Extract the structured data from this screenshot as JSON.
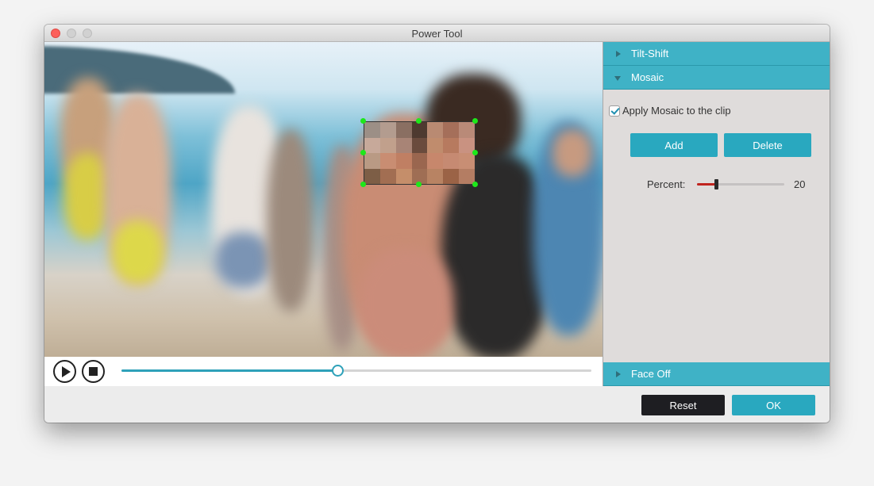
{
  "window": {
    "title": "Power Tool"
  },
  "player": {
    "play_icon": "play-icon",
    "stop_icon": "stop-icon",
    "progress": 0.46
  },
  "mosaic_region": {
    "colors": [
      "#9c8f86",
      "#b39c8f",
      "#8a6f62",
      "#4e3a30",
      "#b98a72",
      "#a56f5a",
      "#b98a78",
      "#c7a99a",
      "#c1a08c",
      "#a88476",
      "#6a4b3d",
      "#c08c6d",
      "#b77a5f",
      "#c99281",
      "#b99a84",
      "#c98d72",
      "#c07f63",
      "#9a664f",
      "#c7876c",
      "#c68a72",
      "#c88e74",
      "#7d5e46",
      "#a26e52",
      "#c58e6a",
      "#9f6e54",
      "#b88363",
      "#9b6346",
      "#b47d63"
    ]
  },
  "panel": {
    "sections": {
      "tilt_shift": {
        "label": "Tilt-Shift",
        "expanded": false
      },
      "mosaic": {
        "label": "Mosaic",
        "expanded": true
      },
      "face_off": {
        "label": "Face Off",
        "expanded": false
      }
    },
    "mosaic": {
      "apply_label": "Apply Mosaic to the clip",
      "apply_checked": true,
      "add_label": "Add",
      "delete_label": "Delete",
      "percent_label": "Percent:",
      "percent_value": "20",
      "percent_fraction": 0.22
    }
  },
  "footer": {
    "reset_label": "Reset",
    "ok_label": "OK"
  },
  "colors": {
    "accent": "#3fb2c6",
    "button_teal": "#29a8bf",
    "reset_dark": "#1e1e22",
    "slider_red": "#c0241e",
    "handle_green": "#1de81a"
  }
}
